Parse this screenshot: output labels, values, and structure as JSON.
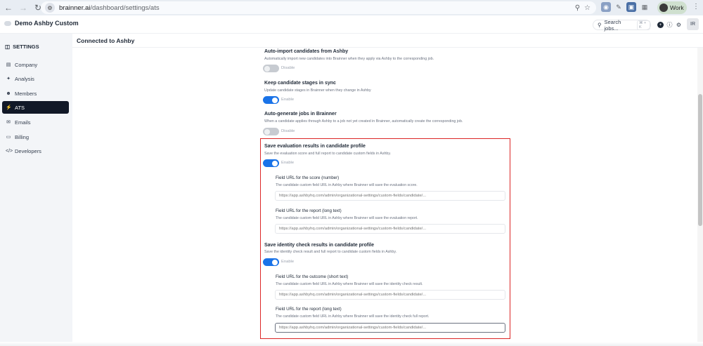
{
  "browser": {
    "url_host": "brainner.ai",
    "url_path": "/dashboard/settings/ats",
    "profile_label": "Work"
  },
  "header": {
    "brand": "Demo Ashby Custom",
    "search_placeholder": "Search jobs...",
    "search_shortcut": "⌘ + K",
    "user_initials": "IR"
  },
  "sidebar": {
    "section_label": "SETTINGS",
    "items": [
      {
        "label": "Company",
        "icon": "building-icon"
      },
      {
        "label": "Analysis",
        "icon": "wand-icon"
      },
      {
        "label": "Members",
        "icon": "users-icon"
      },
      {
        "label": "ATS",
        "icon": "plug-icon",
        "active": true
      },
      {
        "label": "Emails",
        "icon": "mail-icon"
      },
      {
        "label": "Billing",
        "icon": "credit-card-icon"
      },
      {
        "label": "Developers",
        "icon": "code-icon"
      }
    ]
  },
  "main": {
    "title": "Connected to Ashby",
    "settings": [
      {
        "title": "Auto-import candidates from Ashby",
        "desc": "Automatically import new candidates into Brainner when they apply via Ashby to the corresponding job.",
        "toggle": "Disable",
        "on": false
      },
      {
        "title": "Keep candidate stages in sync",
        "desc": "Update candidate stages in Brainner when they change in Ashby",
        "toggle": "Enable",
        "on": true
      },
      {
        "title": "Auto-generate jobs in Brainner",
        "desc": "When a candidate applies through Ashby to a job not yet created in Brainner, automatically create the corresponding job.",
        "toggle": "Disable",
        "on": false
      },
      {
        "title": "Save evaluation results in candidate profile",
        "desc": "Save the evaluation score and full report to candidate custom fields in Ashby.",
        "toggle": "Enable",
        "on": true
      },
      {
        "title": "Save identity check results in candidate profile",
        "desc": "Save the identity check result and full report to candidate custom fields in Ashby.",
        "toggle": "Enable",
        "on": true
      }
    ],
    "fields": [
      {
        "title": "Field URL for the score (number)",
        "desc": "The candidate custom field URL in Ashby where Brainner will save the evaluation score.",
        "placeholder": "https://app.ashbyhq.com/admin/organizational-settings/custom-fields/candidate/..."
      },
      {
        "title": "Field URL for the report (long text)",
        "desc": "The candidate custom field URL in Ashby where Brainner will save the evaluation report.",
        "placeholder": "https://app.ashbyhq.com/admin/organizational-settings/custom-fields/candidate/..."
      },
      {
        "title": "Field URL for the outcome (short text)",
        "desc": "The candidate custom field URL in Ashby where Brainner will save the identity check result.",
        "placeholder": "https://app.ashbyhq.com/admin/organizational-settings/custom-fields/candidate/..."
      },
      {
        "title": "Field URL for the report (long text)",
        "desc": "The candidate custom field URL in Ashby where Brainner will save the identity check full report.",
        "placeholder": "https://app.ashbyhq.com/admin/organizational-settings/custom-fields/candidate/..."
      }
    ]
  },
  "colors": {
    "accent": "#1a73e8",
    "highlight": "#dc2626",
    "sidebar_active": "#111827"
  }
}
